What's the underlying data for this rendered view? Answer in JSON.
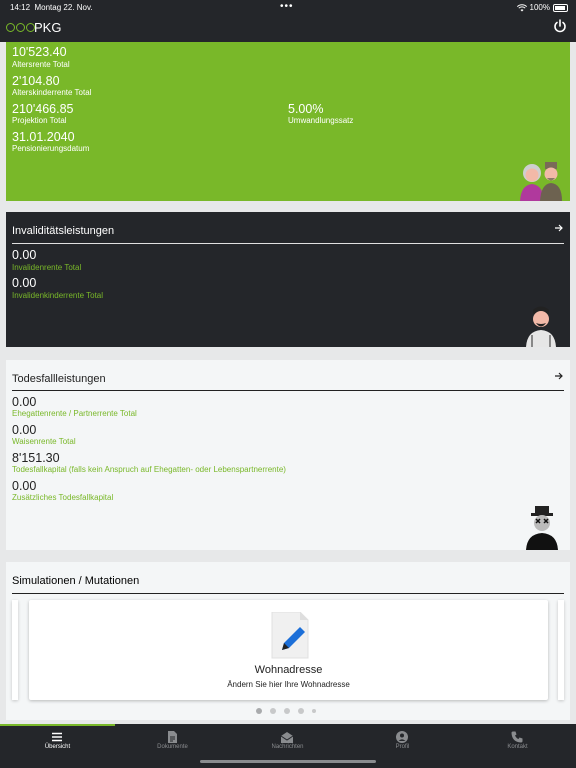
{
  "status": {
    "time": "14:12",
    "date": "Montag 22. Nov.",
    "battery": "100%"
  },
  "app": {
    "title": "PKG"
  },
  "altersleistungen": {
    "items": [
      {
        "value": "10'523.40",
        "label": "Altersrente Total"
      },
      {
        "value": "2'104.80",
        "label": "Alterskinderrente Total"
      },
      {
        "value": "210'466.85",
        "label": "Projektion Total"
      },
      {
        "value": "5.00%",
        "label": "Umwandlungssatz"
      },
      {
        "value": "31.01.2040",
        "label": "Pensionierungsdatum"
      }
    ]
  },
  "invaliditaet": {
    "title": "Invaliditätsleistungen",
    "items": [
      {
        "value": "0.00",
        "label": "Invalidenrente Total"
      },
      {
        "value": "0.00",
        "label": "Invalidenkinderrente Total"
      }
    ]
  },
  "todesfall": {
    "title": "Todesfallleistungen",
    "items": [
      {
        "value": "0.00",
        "label": "Ehegattenrente / Partnerrente Total"
      },
      {
        "value": "0.00",
        "label": "Waisenrente Total"
      },
      {
        "value": "8'151.30",
        "label": "Todesfallkapital (falls kein Anspruch auf Ehegatten- oder Lebenspartnerrente)"
      },
      {
        "value": "0.00",
        "label": "Zusätzliches Todesfallkapital"
      }
    ]
  },
  "simulationen": {
    "title": "Simulationen / Mutationen",
    "card": {
      "title": "Wohnadresse",
      "subtitle": "Ändern Sie hier Ihre Wohnadresse"
    }
  },
  "tabs": [
    {
      "label": "Übersicht",
      "icon": "menu-icon"
    },
    {
      "label": "Dokumente",
      "icon": "document-icon"
    },
    {
      "label": "Nachrichten",
      "icon": "envelope-icon"
    },
    {
      "label": "Profil",
      "icon": "profile-icon"
    },
    {
      "label": "Kontakt",
      "icon": "phone-icon"
    }
  ],
  "colors": {
    "accent": "#79b829",
    "dark": "#24262a",
    "light": "#f4f6f7"
  }
}
